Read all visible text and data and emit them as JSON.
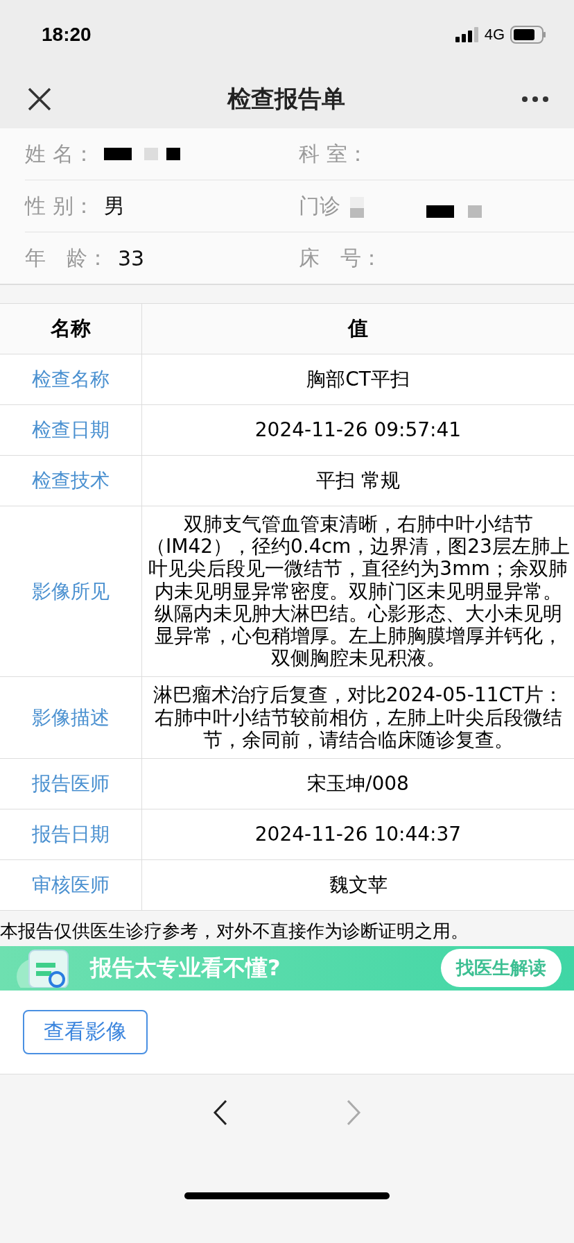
{
  "status_bar": {
    "time": "18:20",
    "network": "4G"
  },
  "nav": {
    "title": "检查报告单"
  },
  "patient": [
    {
      "label": "姓 名：",
      "kind": "redacted"
    },
    {
      "label": "科 室：",
      "kind": "empty"
    },
    {
      "label": "性 别：",
      "kind": "text",
      "value": "男"
    },
    {
      "label": "门诊",
      "kind": "redacted"
    },
    {
      "label": "年　龄：",
      "kind": "text",
      "value": "33"
    },
    {
      "label": "床　号：",
      "kind": "empty"
    }
  ],
  "table": {
    "columns": [
      "名称",
      "值"
    ],
    "rows": [
      {
        "name": "检查名称",
        "value": "胸部CT平扫"
      },
      {
        "name": "检查日期",
        "value": "2024-11-26 09:57:41"
      },
      {
        "name": "检查技术",
        "value": "平扫 常规"
      },
      {
        "name": "影像所见",
        "value": "双肺支气管血管束清晰，右肺中叶小结节（IM42），径约0.4cm，边界清，图23层左肺上叶见尖后段见一微结节，直径约为3mm；余双肺内未见明显异常密度。双肺门区未见明显异常。纵隔内未见肿大淋巴结。心影形态、大小未见明显异常，心包稍增厚。左上肺胸膜增厚并钙化，双侧胸腔未见积液。"
      },
      {
        "name": "影像描述",
        "value": "淋巴瘤术治疗后复查，对比2024-05-11CT片：右肺中叶小结节较前相仿，左肺上叶尖后段微结节，余同前，请结合临床随诊复查。"
      },
      {
        "name": "报告医师",
        "value": "宋玉坤/008"
      },
      {
        "name": "报告日期",
        "value": "2024-11-26 10:44:37"
      },
      {
        "name": "审核医师",
        "value": "魏文苹"
      }
    ]
  },
  "disclaimer": "本报告仅供医生诊疗参考，对外不直接作为诊断证明之用。",
  "banner": {
    "text": "报告太专业看不懂?",
    "button": "找医生解读"
  },
  "actions": [
    {
      "label": "查看影像"
    }
  ],
  "browser_nav": {
    "back_disabled": false,
    "forward_disabled": true
  }
}
